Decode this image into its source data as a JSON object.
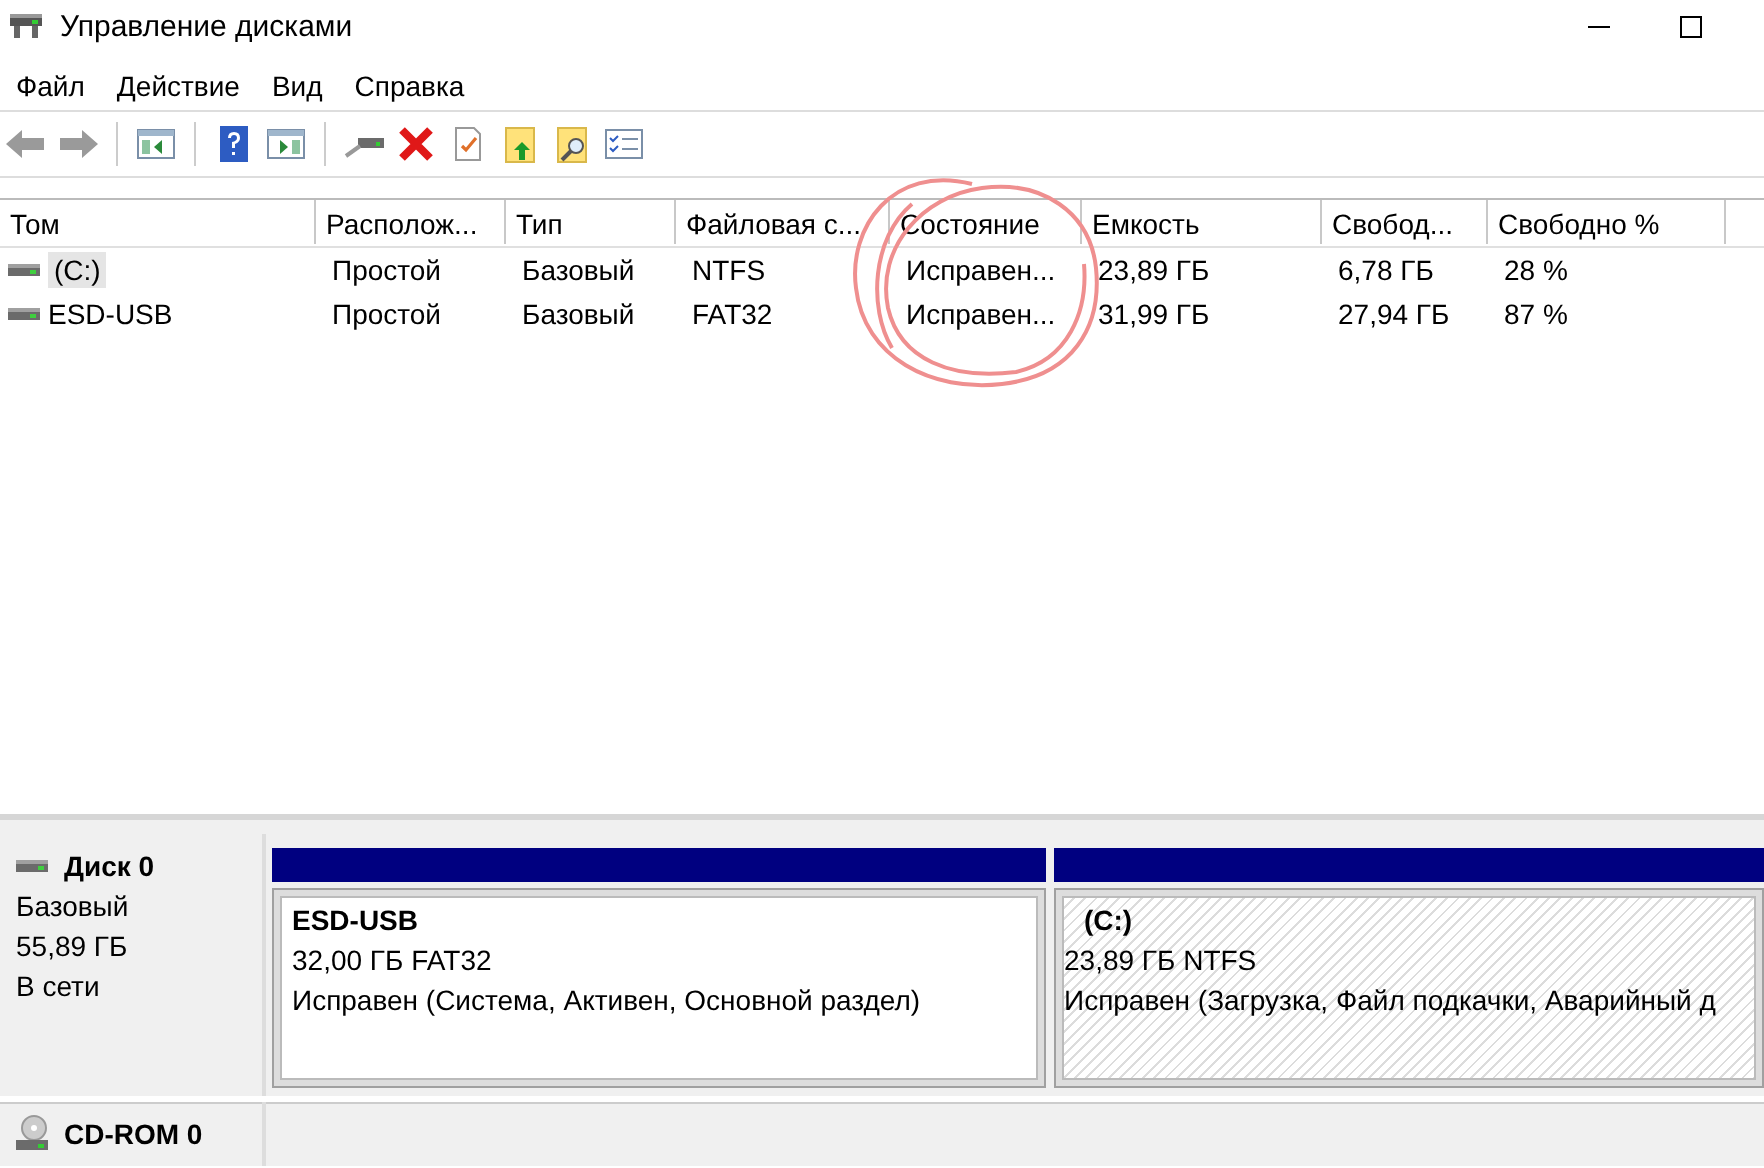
{
  "window": {
    "title": "Управление дисками"
  },
  "menu": [
    "Файл",
    "Действие",
    "Вид",
    "Справка"
  ],
  "table": {
    "columns": [
      "Том",
      "Располож...",
      "Тип",
      "Файловая с...",
      "Состояние",
      "Емкость",
      "Свобод...",
      "Свободно %"
    ],
    "rows": [
      {
        "kind": "drive",
        "selected": true,
        "cells": [
          "(C:)",
          "Простой",
          "Базовый",
          "NTFS",
          "Исправен...",
          "23,89 ГБ",
          "6,78 ГБ",
          "28 %"
        ]
      },
      {
        "kind": "drive",
        "selected": false,
        "cells": [
          "ESD-USB",
          "Простой",
          "Базовый",
          "FAT32",
          "Исправен...",
          "31,99 ГБ",
          "27,94 ГБ",
          "87 %"
        ]
      }
    ]
  },
  "disks": [
    {
      "kind": "disk",
      "name": "Диск 0",
      "type": "Базовый",
      "size": "55,89 ГБ",
      "status": "В сети",
      "partitions": [
        {
          "name": "ESD-USB",
          "size": "32,00 ГБ FAT32",
          "status": "Исправен (Система, Активен, Основной раздел)",
          "selected": false
        },
        {
          "name": "(C:)",
          "size": "23,89 ГБ NTFS",
          "status": "Исправен (Загрузка, Файл подкачки, Аварийный д",
          "selected": true
        }
      ]
    },
    {
      "kind": "cdrom",
      "name": "CD-ROM 0"
    }
  ]
}
